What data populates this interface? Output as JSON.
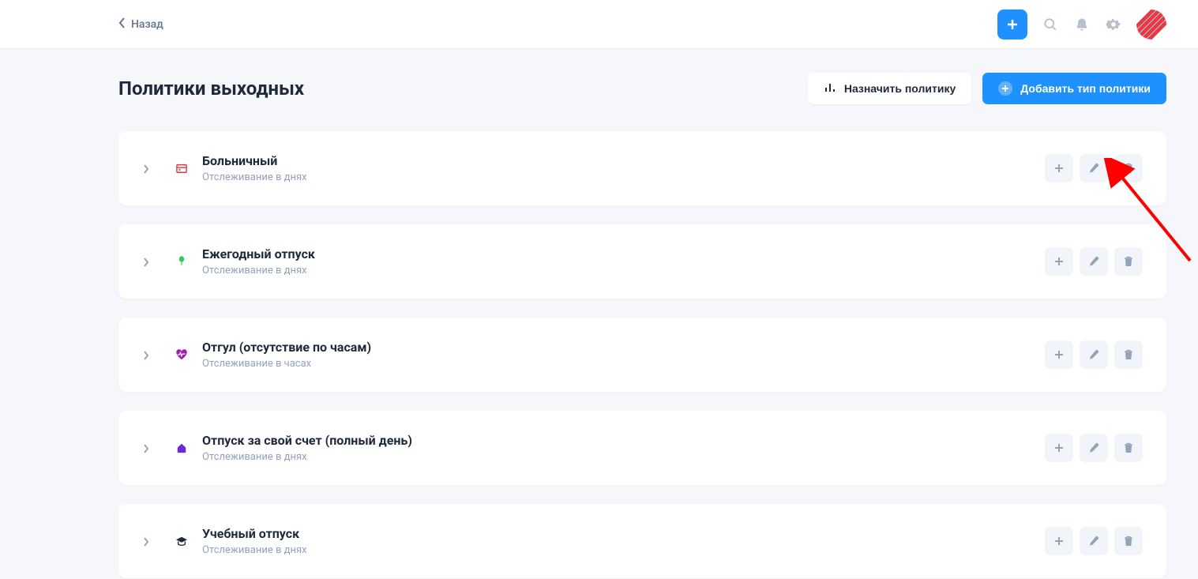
{
  "topbar": {
    "back_label": "Назад"
  },
  "page": {
    "title": "Политики выходных",
    "assign_label": "Назначить политику",
    "add_type_label": "Добавить тип политики"
  },
  "policies": [
    {
      "title": "Больничный",
      "subtitle": "Отслеживание в днях",
      "icon": "calendar",
      "icon_color": "#d63a3a"
    },
    {
      "title": "Ежегодный отпуск",
      "subtitle": "Отслеживание в днях",
      "icon": "balloon",
      "icon_color": "#34c759"
    },
    {
      "title": "Отгул (отсутствие по часам)",
      "subtitle": "Отслеживание в часах",
      "icon": "heartbeat",
      "icon_color": "#a21caf"
    },
    {
      "title": "Отпуск за свой счет (полный день)",
      "subtitle": "Отслеживание в днях",
      "icon": "house",
      "icon_color": "#6d28d9"
    },
    {
      "title": "Учебный отпуск",
      "subtitle": "Отслеживание в днях",
      "icon": "grad-cap",
      "icon_color": "#1e293b"
    }
  ]
}
